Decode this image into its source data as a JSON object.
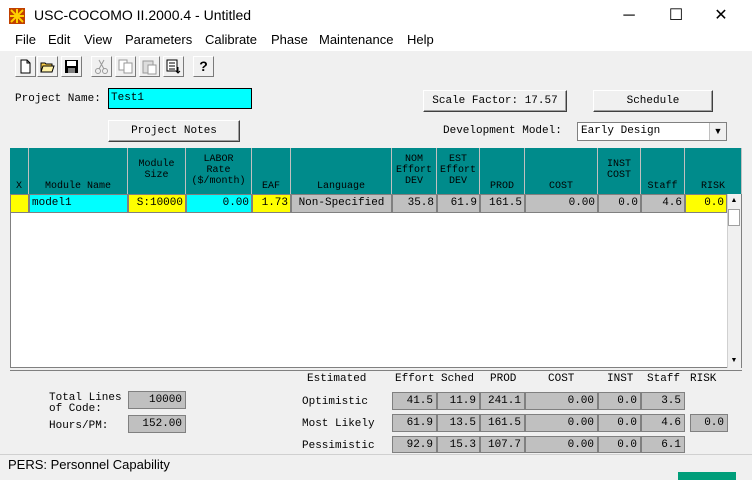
{
  "window": {
    "title": "USC-COCOMO II.2000.4 - Untitled",
    "minimize": "─",
    "maximize": "☐",
    "close": "✕"
  },
  "menu": [
    "File",
    "Edit",
    "View",
    "Parameters",
    "Calibrate",
    "Phase",
    "Maintenance",
    "Help"
  ],
  "toolbar": {
    "help_label": "?"
  },
  "project": {
    "name_label": "Project Name:",
    "name_value": "Test1",
    "scale_factor_label": "Scale Factor: 17.57",
    "schedule_label": "Schedule",
    "notes_label": "Project Notes",
    "dev_model_label": "Development Model:",
    "dev_model_value": "Early Design"
  },
  "grid": {
    "headers": {
      "x": "X",
      "module_name": "Module Name",
      "module_size_1": "Module",
      "module_size_2": "Size",
      "labor_1": "LABOR",
      "labor_2": "Rate",
      "labor_3": "($/month)",
      "eaf": "EAF",
      "language": "Language",
      "nom_1": "NOM",
      "nom_2": "Effort",
      "nom_3": "DEV",
      "est_1": "EST",
      "est_2": "Effort",
      "est_3": "DEV",
      "prod": "PROD",
      "cost": "COST",
      "inst_1": "INST",
      "inst_2": "COST",
      "staff": "Staff",
      "risk": "RISK"
    },
    "row": {
      "x": "",
      "module_name": "model1",
      "module_size": "S:10000",
      "labor": "0.00",
      "eaf": "1.73",
      "language": "Non-Specified",
      "nom_dev": "35.8",
      "est_dev": "61.9",
      "prod": "161.5",
      "cost": "0.00",
      "inst_cost": "0.0",
      "staff": "4.6",
      "risk": "0.0"
    }
  },
  "summary": {
    "total_lines_label_1": "Total Lines",
    "total_lines_label_2": "of Code:",
    "total_lines_value": "10000",
    "hours_label": "Hours/PM:",
    "hours_value": "152.00",
    "headers": {
      "estimated": "Estimated",
      "effort": "Effort",
      "sched": "Sched",
      "prod": "PROD",
      "cost": "COST",
      "inst": "INST",
      "staff": "Staff",
      "risk": "RISK"
    },
    "rows": [
      {
        "label": "Optimistic",
        "effort": "41.5",
        "sched": "11.9",
        "prod": "241.1",
        "cost": "0.00",
        "inst": "0.0",
        "staff": "3.5",
        "risk": ""
      },
      {
        "label": "Most Likely",
        "effort": "61.9",
        "sched": "13.5",
        "prod": "161.5",
        "cost": "0.00",
        "inst": "0.0",
        "staff": "4.6",
        "risk": "0.0"
      },
      {
        "label": "Pessimistic",
        "effort": "92.9",
        "sched": "15.3",
        "prod": "107.7",
        "cost": "0.00",
        "inst": "0.0",
        "staff": "6.1",
        "risk": ""
      }
    ]
  },
  "status": {
    "text": "PERS: Personnel Capability"
  },
  "colors": {
    "header_teal": "#008b8b",
    "cyan": "#00ffff",
    "yellow": "#ffff00",
    "grey": "#c0c0c0"
  }
}
